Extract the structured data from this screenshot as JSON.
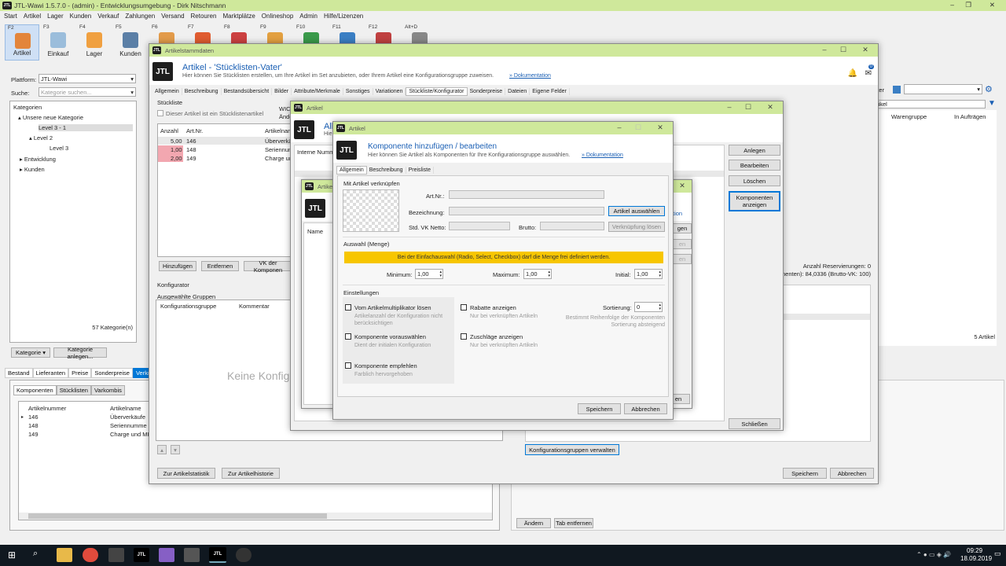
{
  "app_title": "JTL-Wawi 1.5.7.0 - (admin) - Entwicklungsumgebung - Dirk Nitschmann",
  "menu": [
    "Start",
    "Artikel",
    "Lager",
    "Kunden",
    "Verkauf",
    "Zahlungen",
    "Versand",
    "Retouren",
    "Marktplätze",
    "Onlineshop",
    "Admin",
    "Hilfe/Lizenzen"
  ],
  "toolbar": [
    {
      "key": "F2",
      "label": "Artikel",
      "color": "#e3853b"
    },
    {
      "key": "F3",
      "label": "Einkauf",
      "color": "#9bbddb"
    },
    {
      "key": "F4",
      "label": "Lager",
      "color": "#f0a040"
    },
    {
      "key": "F5",
      "label": "Kunden",
      "color": "#5b7fa6"
    },
    {
      "key": "F6",
      "label": "",
      "color": "#e39b4a"
    },
    {
      "key": "F7",
      "label": "",
      "color": "#e05c30"
    },
    {
      "key": "F8",
      "label": "",
      "color": "#cc4040"
    },
    {
      "key": "F9",
      "label": "",
      "color": "#e3a040"
    },
    {
      "key": "F10",
      "label": "",
      "color": "#3a9a4a"
    },
    {
      "key": "F11",
      "label": "",
      "color": "#3b7fc4"
    },
    {
      "key": "F12",
      "label": "",
      "color": "#c04040"
    },
    {
      "key": "Alt+D",
      "label": "",
      "color": "#888"
    }
  ],
  "left": {
    "platform_label": "Plattform:",
    "platform_value": "JTL-Wawi",
    "search_label": "Suche:",
    "search_placeholder": "Kategorie suchen...",
    "tree_header": "Kategorien",
    "tree": [
      "Unsere neue Kategorie",
      "Level 3 - 1",
      "Level 2",
      "Level 3",
      "Entwicklung",
      "Kunden"
    ],
    "count": "57 Kategorie(n)",
    "btn_kategorie": "Kategorie ▾",
    "btn_anlegen": "Kategorie anlegen..."
  },
  "bottom_tabs": [
    "Bestand",
    "Lieferanten",
    "Preise",
    "Sonderpreise",
    "Verknü"
  ],
  "bottom_subtabs": [
    "Komponenten",
    "Stücklisten",
    "Varkombis"
  ],
  "bottom_grid": {
    "headers": [
      "Artikelnummer",
      "Artikelname"
    ],
    "rows": [
      [
        "146",
        "Überverkäufe"
      ],
      [
        "148",
        "Seriennumme"
      ],
      [
        "149",
        "Charge und MH"
      ]
    ]
  },
  "right_panel": {
    "filter_label": "ilter",
    "artikel_label": "rtikel",
    "headers": [
      "Warengruppe",
      "In Aufträgen"
    ],
    "count": "5 Artikel",
    "btn_andern": "Ändern",
    "btn_tab": "Tab entfernen"
  },
  "win_stamm": {
    "title": "Artikelstammdaten",
    "heading": "Artikel - 'Stücklisten-Vater'",
    "desc": "Hier können Sie Stücklisten erstellen, um Ihre Artikel im Set anzubieten, oder Ihrem Artikel eine Konfigurationsgruppe zuweisen.",
    "doc": "» Dokumentation",
    "badge": "0",
    "tabs": [
      "Allgemein",
      "Beschreibung",
      "Bestandsübersicht",
      "Bilder",
      "Attribute/Merkmale",
      "Sonstiges",
      "Variationen",
      "Stückliste/Konfigurator",
      "Sonderpreise",
      "Dateien",
      "Eigene Felder"
    ],
    "stueckliste_label": "Stückliste",
    "chk_vater": "Dieser Artikel ist ein Stücklistenartikel",
    "wic": "WIC",
    "ande": "Ände",
    "grid_headers": [
      "Anzahl",
      "Art.Nr.",
      "Artikelnam"
    ],
    "grid_rows": [
      [
        "5,00",
        "146",
        "Überverkä"
      ],
      [
        "1,00",
        "148",
        "Seriennum"
      ],
      [
        "2,00",
        "149",
        "Charge und"
      ]
    ],
    "btn_hinzu": "Hinzufügen",
    "btn_entf": "Entfernen",
    "btn_vk": "VK der Komponen",
    "konfigurator": "Konfigurator",
    "ausgew": "Ausgewählte Gruppen",
    "konf_headers": [
      "Konfigurationsgruppe",
      "Kommentar"
    ],
    "keine": "Keine Konfigu",
    "reserv": "Anzahl Reservierungen: 0",
    "brutto": "onenten): 84,0336 (Brutto-VK: 100)",
    "btn_konfverw": "Konfigurationsgruppen verwalten",
    "btn_statistik": "Zur Artikelstatistik",
    "btn_historie": "Zur Artikelhistorie",
    "btn_speichern": "Speichern",
    "btn_abbrechen": "Abbrechen"
  },
  "win_artikel1": {
    "title": "Artikel",
    "heading": "Allg",
    "hint": "Hier",
    "interne": "Interne Numme",
    "btn_anlegen": "Anlegen",
    "btn_bearb": "Bearbeiten",
    "btn_loeschen": "Löschen",
    "btn_komp": "Komponenten anzeigen",
    "btn_schliessen": "Schließen"
  },
  "win_artikel_back": {
    "title": "Artike",
    "name_col": "Name",
    "frag1": "tion",
    "frag2": "gen",
    "frag3": "en",
    "frag4": "en"
  },
  "dialog": {
    "title": "Artikel",
    "heading": "Komponente hinzufügen / bearbeiten",
    "desc": "Hier können Sie Artikel als Komponenten für Ihre Konfigurationsgruppe auswählen.",
    "doc": "» Dokumentation",
    "tabs": [
      "Allgemein",
      "Beschreibung",
      "Preisliste"
    ],
    "sec_link": "Mit Artikel verknüpfen",
    "artnr_label": "Art.Nr.:",
    "bez_label": "Bezeichnung:",
    "vk_label": "Std. VK Netto:",
    "brutto_label": "Brutto:",
    "btn_auswaehlen": "Artikel auswählen",
    "btn_loesen": "Verknüpfung lösen",
    "sec_menge": "Auswahl (Menge)",
    "warning": "Bei der Einfachauswahl (Radio, Select, Checkbox) darf die Menge frei definiert werden.",
    "min_label": "Minimum:",
    "min_value": "1,00",
    "max_label": "Maximum:",
    "max_value": "1,00",
    "init_label": "Initial:",
    "init_value": "1,00",
    "sec_einst": "Einstellungen",
    "chk1": "Vom Artikelmultiplikator lösen",
    "chk1_sub": "Artikelanzahl der Konfiguration nicht berücksichtigen",
    "chk2": "Komponente vorauswählen",
    "chk2_sub": "Dient der initialen Konfiguration",
    "chk3": "Komponente empfehlen",
    "chk3_sub": "Farblich hervorgehoben",
    "chk4": "Rabatte anzeigen",
    "chk4_sub": "Nur bei verknüpften Artikeln",
    "chk5": "Zuschläge anzeigen",
    "chk5_sub": "Nur bei verknüpften Artikeln",
    "sort_label": "Sortierung:",
    "sort_value": "0",
    "sort_sub": "Bestimmt Reihenfolge der Komponenten Sortierung absteigend",
    "btn_speichern": "Speichern",
    "btn_abbrechen": "Abbrechen"
  },
  "clock": {
    "time": "09:29",
    "date": "18.09.2019"
  }
}
